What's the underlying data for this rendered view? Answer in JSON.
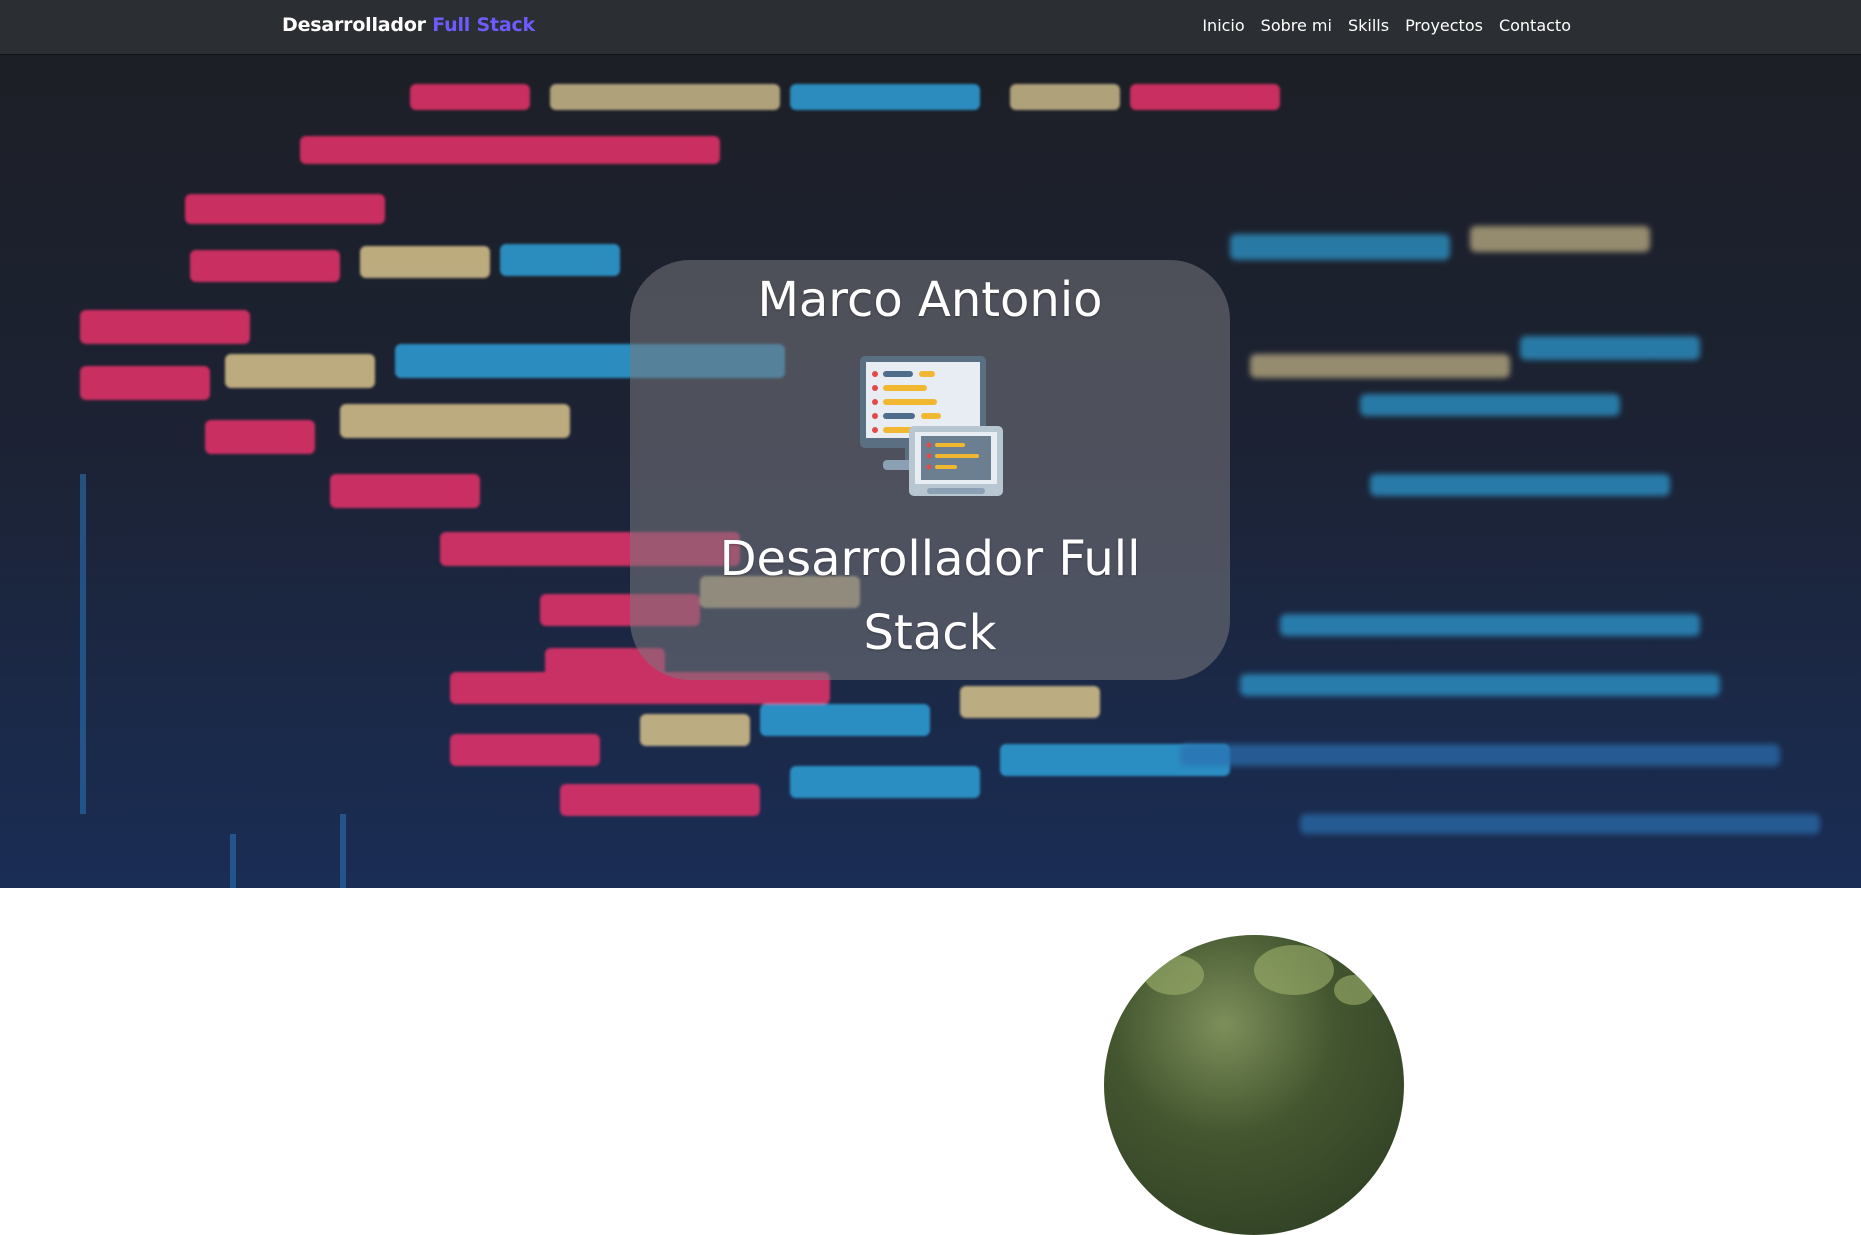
{
  "navbar": {
    "brand_main": "Desarrollador",
    "brand_accent": "Full Stack",
    "links": [
      "Inicio",
      "Sobre mi",
      "Skills",
      "Proyectos",
      "Contacto"
    ]
  },
  "hero": {
    "name": "Marco Antonio",
    "title": "Desarrollador Full Stack",
    "icon": "code-monitors-icon"
  },
  "colors": {
    "navbar_bg": "#2b2e32",
    "brand_accent": "#6c5cff",
    "card_bg": "rgba(120,120,125,0.55)"
  }
}
